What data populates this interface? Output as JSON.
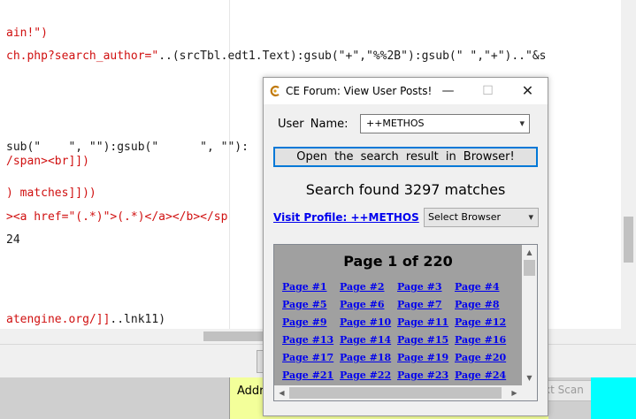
{
  "editor": {
    "lines": [
      {
        "text_red": "ain!\")",
        "text_dark": ""
      },
      {
        "text_red": "ch.php?search_author=\"",
        "text_dark": "..(srcTbl.edt1.Text):gsub(\"+\",\"%%2B\"):gsub(\" \",\"+\")..\"&s"
      },
      {
        "text_red": "sub(\"    \", \"\"):gsub(\"      \", \"\"):",
        "text_dark": ""
      },
      {
        "text_red": "/span><br]])",
        "text_dark": ""
      },
      {
        "text_red": ") matches]]))",
        "text_dark": ""
      },
      {
        "text_red": "><a href=\"(.*)\">(.*)</a></b></sp",
        "text_dark": ""
      },
      {
        "text_red": "",
        "text_dark": "24"
      },
      {
        "text_red": "atengine.org/]]",
        "text_dark": "..lnk11)"
      }
    ]
  },
  "bottom": {
    "address_label": "Addre",
    "text_scan_label": "xt Scan"
  },
  "dialog": {
    "title": "CE Forum: View User Posts!",
    "minimize_glyph": "—",
    "maximize_glyph": "☐",
    "close_glyph": "✕",
    "user_name_label": "User  Name:",
    "user_name_value": "++METHOS",
    "open_button_label": "Open  the  search  result  in  Browser!",
    "search_result_text": "Search found 3297 matches",
    "visit_profile_label": "Visit Profile:  ++METHOS",
    "browser_select_value": "Select Browser",
    "pages_header": "Page 1 of 220",
    "page_links": [
      "Page #1",
      "Page #2",
      "Page #3",
      "Page #4",
      "Page #5",
      "Page #6",
      "Page #7",
      "Page #8",
      "Page #9",
      "Page #10",
      "Page #11",
      "Page #12",
      "Page #13",
      "Page #14",
      "Page #15",
      "Page #16",
      "Page #17",
      "Page #18",
      "Page #19",
      "Page #20",
      "Page #21",
      "Page #22",
      "Page #23",
      "Page #24"
    ]
  },
  "icons": {
    "app_icon": "cheat-engine-icon",
    "chevron": "▾",
    "scroll_up": "▲",
    "scroll_down": "▼",
    "scroll_left": "◀",
    "scroll_right": "▶"
  },
  "colors": {
    "link": "#0000ee",
    "code_string": "#d01010",
    "focus_border": "#0078d7",
    "address_bg": "#f3ff9a",
    "cyan_bg": "#00ffff",
    "pages_bg": "#a0a0a0"
  }
}
